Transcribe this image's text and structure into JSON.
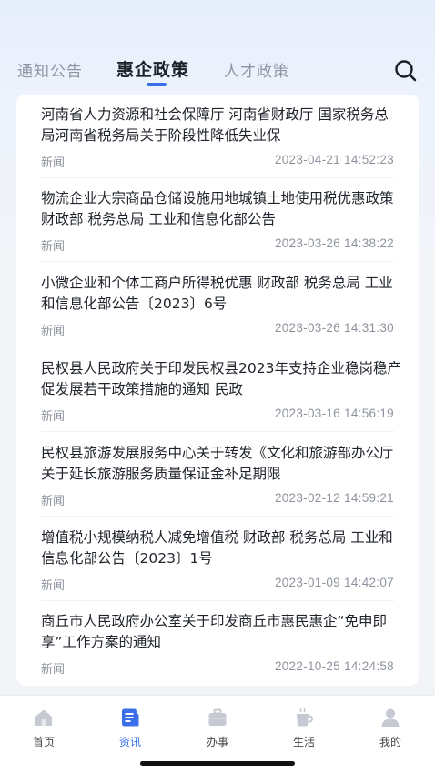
{
  "tabs": [
    {
      "label": "通知公告"
    },
    {
      "label": "惠企政策"
    },
    {
      "label": "人才政策"
    }
  ],
  "search_icon": "search-icon",
  "news": [
    {
      "title": "河南省人力资源和社会保障厅 河南省财政厅 国家税务总局河南省税务局关于阶段性降低失业保",
      "tag": "新闻",
      "time": "2023-04-21 14:52:23"
    },
    {
      "title": "物流企业大宗商品仓储设施用地城镇土地使用税优惠政策 财政部 税务总局 工业和信息化部公告",
      "tag": "新闻",
      "time": "2023-03-26 14:38:22"
    },
    {
      "title": "小微企业和个体工商户所得税优惠 财政部 税务总局 工业和信息化部公告〔2023〕6号",
      "tag": "新闻",
      "time": "2023-03-26 14:31:30"
    },
    {
      "title": "民权县人民政府关于印发民权县2023年支持企业稳岗稳产促发展若干政策措施的通知 民政",
      "tag": "新闻",
      "time": "2023-03-16 14:56:19"
    },
    {
      "title": "民权县旅游发展服务中心关于转发《文化和旅游部办公厅关于延长旅游服务质量保证金补足期限",
      "tag": "新闻",
      "time": "2023-02-12 14:59:21"
    },
    {
      "title": "增值税小规模纳税人减免增值税 财政部 税务总局 工业和信息化部公告〔2023〕1号",
      "tag": "新闻",
      "time": "2023-01-09 14:42:07"
    },
    {
      "title": "商丘市人民政府办公室关于印发商丘市惠民惠企“免申即享”工作方案的通知",
      "tag": "新闻",
      "time": "2022-10-25 14:24:58"
    }
  ],
  "bottom_nav": [
    {
      "label": "首页",
      "icon": "home-icon"
    },
    {
      "label": "资讯",
      "icon": "news-icon"
    },
    {
      "label": "办事",
      "icon": "briefcase-icon"
    },
    {
      "label": "生活",
      "icon": "cup-icon"
    },
    {
      "label": "我的",
      "icon": "user-icon"
    }
  ],
  "colors": {
    "accent": "#3b6fea",
    "inactive_icon": "#c4c9d2"
  }
}
